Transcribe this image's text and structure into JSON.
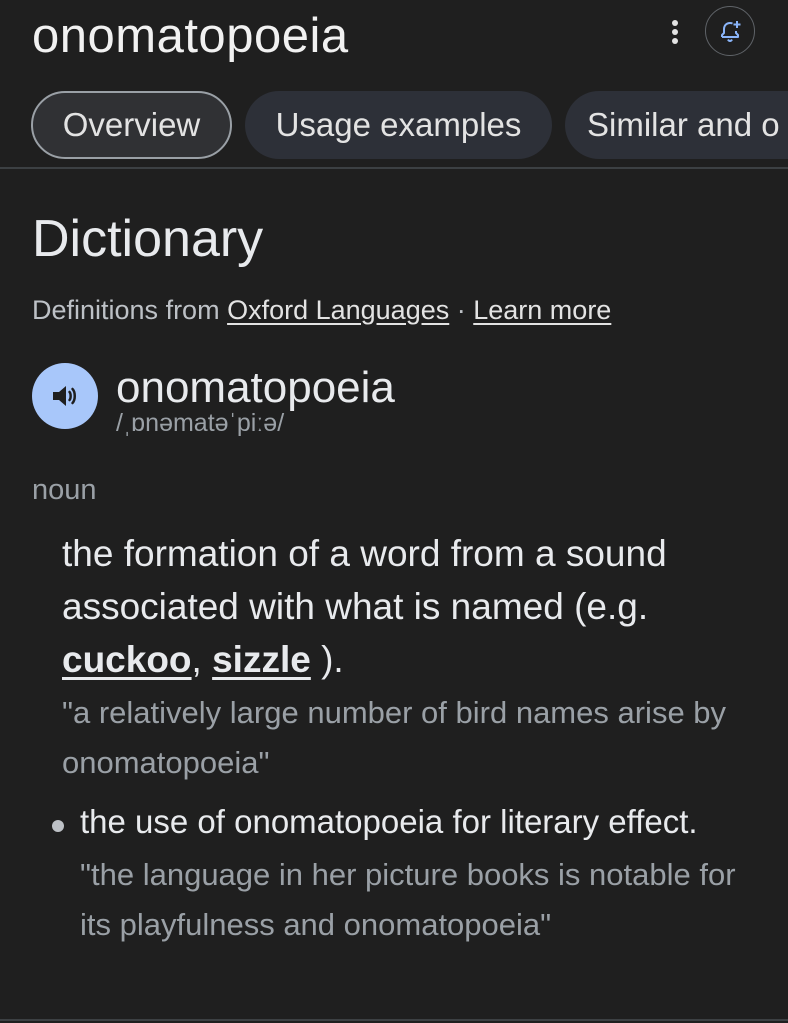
{
  "header": {
    "title": "onomatopoeia",
    "more_icon": "more-vertical-icon",
    "alert_icon": "add-alert-icon"
  },
  "tabs": [
    {
      "label": "Overview",
      "active": true
    },
    {
      "label": "Usage examples",
      "active": false
    },
    {
      "label": "Similar and o",
      "active": false
    }
  ],
  "dictionary": {
    "heading": "Dictionary",
    "source_prefix": "Definitions from ",
    "source_link": "Oxford Languages",
    "separator": " · ",
    "learn_more": "Learn more",
    "speaker_icon": "volume-icon",
    "word": "onomatopoeia",
    "phonetic": "/ˌɒnəmatəˈpiːə/",
    "part_of_speech": "noun",
    "definition": {
      "text_before": "the formation of a word from a sound associated with what is named (e.g. ",
      "link1": "cuckoo",
      "comma": ", ",
      "link2": "sizzle",
      "text_after": " ).",
      "example": "\"a relatively large number of bird names arise by onomatopoeia\""
    },
    "subsense": {
      "text": "the use of onomatopoeia for literary effect.",
      "example": "\"the language in her picture books is notable for its playfulness and onomatopoeia\""
    }
  },
  "colors": {
    "background": "#1f1f1f",
    "speaker_button": "#a8c7fa",
    "active_tab_border": "#9aa0a6",
    "alert_icon": "#8ab4f8"
  }
}
